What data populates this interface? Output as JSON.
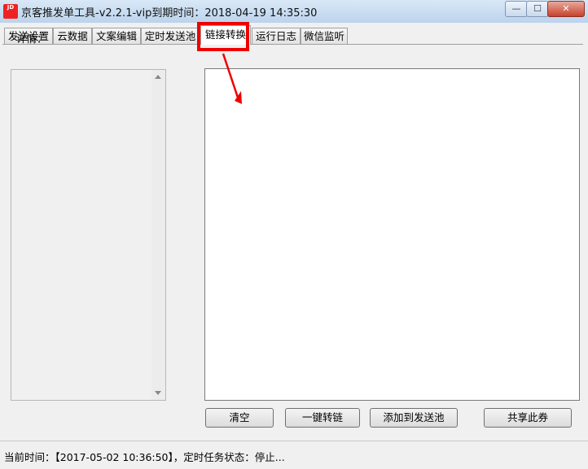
{
  "window": {
    "app_icon_text": "JD",
    "title": "京客推发单工具-v2.2.1-vip到期时间：2018-04-19 14:35:30",
    "min_icon": "minimize-icon",
    "max_icon": "maximize-icon",
    "close_icon": "close-icon"
  },
  "tabs": [
    {
      "label": "发送设置"
    },
    {
      "label": "云数据"
    },
    {
      "label": "文案编辑"
    },
    {
      "label": "定时发送池"
    },
    {
      "label": "链接转换"
    },
    {
      "label": "运行日志"
    },
    {
      "label": "微信监听"
    }
  ],
  "active_tab": "链接转换",
  "left_panel": {
    "detail_label": "详情："
  },
  "buttons": {
    "clear": "清空",
    "convert": "一键转链",
    "add_pool": "添加到发送池",
    "share": "共享此券"
  },
  "status": {
    "text": "当前时间：【2017-05-02 10:36:50】，定时任务状态：停止..."
  },
  "annotation": {
    "highlight_color": "#e00000"
  }
}
